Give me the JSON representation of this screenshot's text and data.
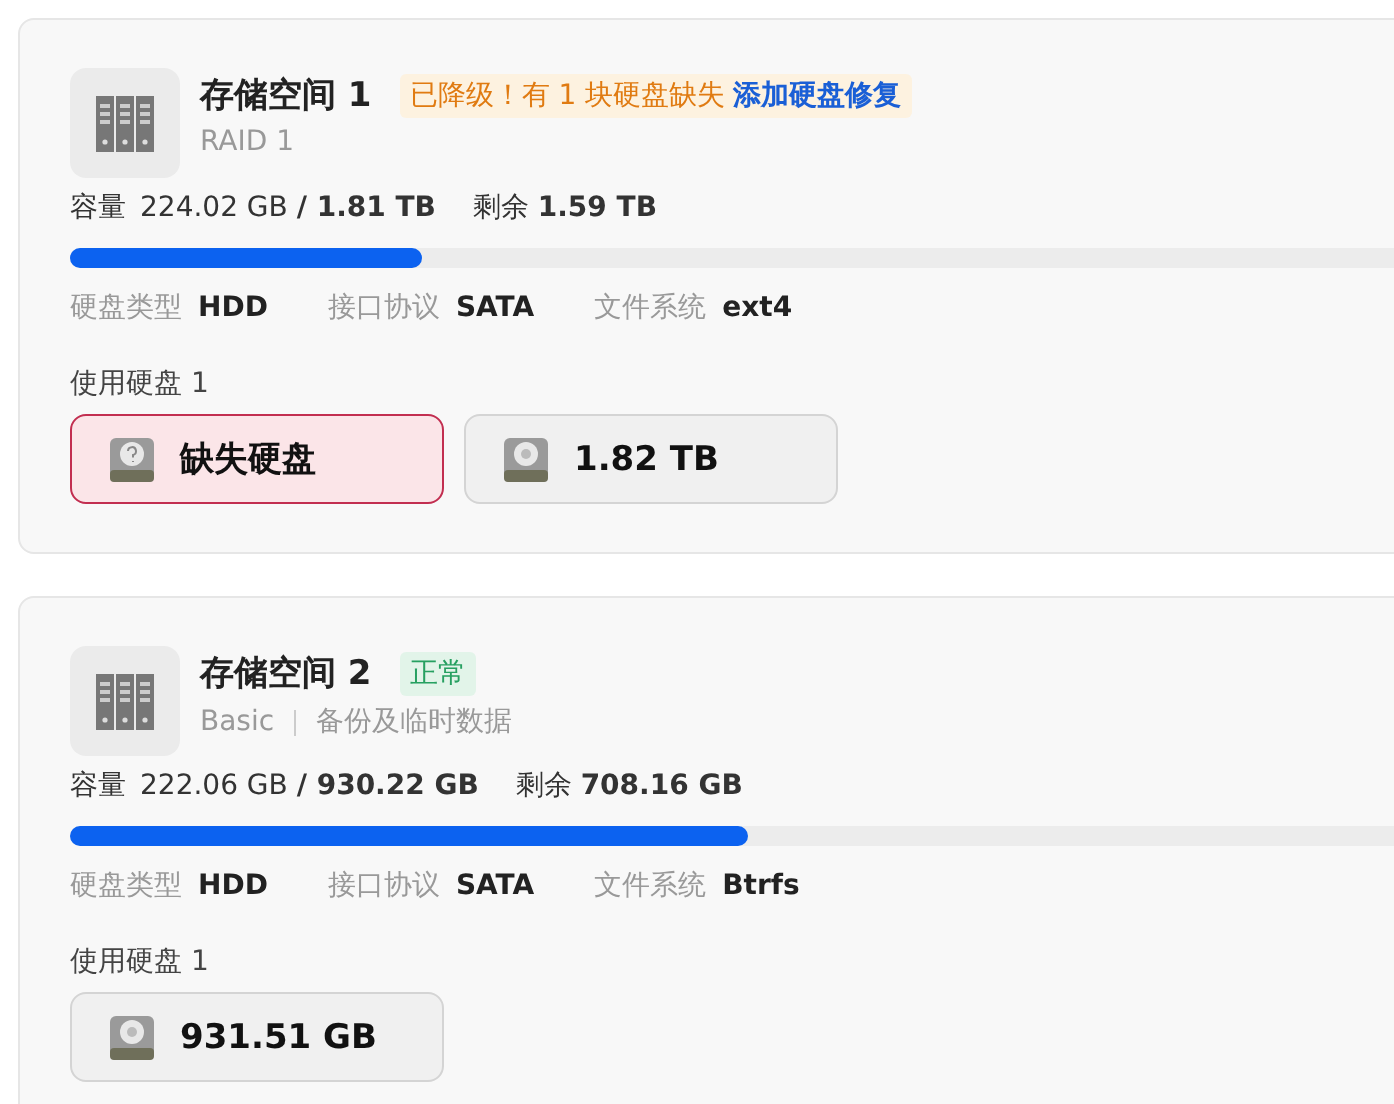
{
  "pools": [
    {
      "title": "存储空间 1",
      "status": {
        "kind": "degraded",
        "text": "已降级！有 1 块硬盘缺失",
        "link": "添加硬盘修复"
      },
      "subtitle": [
        "RAID 1"
      ],
      "capacity": {
        "label": "容量",
        "used": "224.02 GB",
        "total": "/ 1.81 TB",
        "free_label": "剩余",
        "free": "1.59 TB",
        "level": 0.124
      },
      "info": [
        {
          "label": "硬盘类型",
          "value": "HDD"
        },
        {
          "label": "接口协议",
          "value": "SATA"
        },
        {
          "label": "文件系统",
          "value": "ext4"
        }
      ],
      "disks_label": "使用硬盘 1",
      "disks": [
        {
          "kind": "missing",
          "text": "缺失硬盘"
        },
        {
          "kind": "normal",
          "text": "1.82 TB"
        }
      ]
    },
    {
      "title": "存储空间 2",
      "status": {
        "kind": "normal",
        "text": "正常"
      },
      "subtitle": [
        "Basic",
        "备份及临时数据"
      ],
      "capacity": {
        "label": "容量",
        "used": "222.06 GB",
        "total": "/ 930.22 GB",
        "free_label": "剩余",
        "free": "708.16 GB",
        "level": 0.239
      },
      "info": [
        {
          "label": "硬盘类型",
          "value": "HDD"
        },
        {
          "label": "接口协议",
          "value": "SATA"
        },
        {
          "label": "文件系统",
          "value": "Btrfs"
        }
      ],
      "disks_label": "使用硬盘 1",
      "disks": [
        {
          "kind": "normal",
          "text": "931.51 GB"
        }
      ]
    }
  ]
}
